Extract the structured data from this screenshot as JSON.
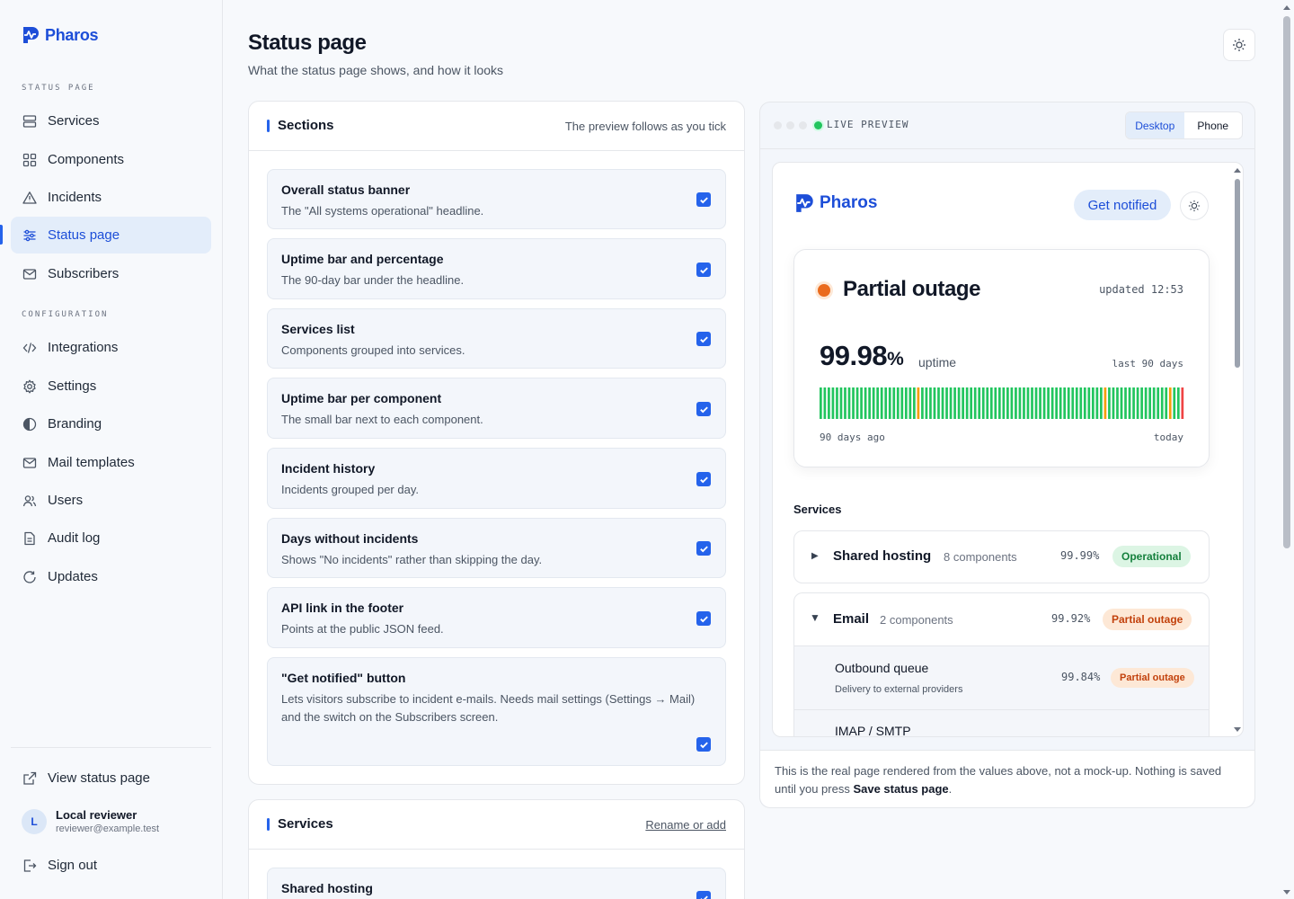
{
  "brand": {
    "name": "Pharos"
  },
  "sidebar": {
    "section_status": "STATUS PAGE",
    "section_config": "CONFIGURATION",
    "items": [
      {
        "label": "Services",
        "icon": "server-icon"
      },
      {
        "label": "Components",
        "icon": "grid-icon"
      },
      {
        "label": "Incidents",
        "icon": "warning-icon"
      },
      {
        "label": "Status page",
        "icon": "sliders-icon",
        "active": true
      },
      {
        "label": "Subscribers",
        "icon": "mail-icon"
      },
      {
        "label": "Integrations",
        "icon": "code-icon"
      },
      {
        "label": "Settings",
        "icon": "gear-icon"
      },
      {
        "label": "Branding",
        "icon": "contrast-icon"
      },
      {
        "label": "Mail templates",
        "icon": "mail-icon"
      },
      {
        "label": "Users",
        "icon": "users-icon"
      },
      {
        "label": "Audit log",
        "icon": "file-icon"
      },
      {
        "label": "Updates",
        "icon": "refresh-icon"
      }
    ],
    "view_status": "View status page",
    "user": {
      "initial": "L",
      "name": "Local reviewer",
      "email": "reviewer@example.test"
    },
    "sign_out": "Sign out"
  },
  "header": {
    "title": "Status page",
    "subtitle": "What the status page shows, and how it looks"
  },
  "sections_card": {
    "title": "Sections",
    "hint": "The preview follows as you tick",
    "options": [
      {
        "title": "Overall status banner",
        "desc": "The \"All systems operational\" headline.",
        "checked": true
      },
      {
        "title": "Uptime bar and percentage",
        "desc": "The 90-day bar under the headline.",
        "checked": true
      },
      {
        "title": "Services list",
        "desc": "Components grouped into services.",
        "checked": true
      },
      {
        "title": "Uptime bar per component",
        "desc": "The small bar next to each component.",
        "checked": true
      },
      {
        "title": "Incident history",
        "desc": "Incidents grouped per day.",
        "checked": true
      },
      {
        "title": "Days without incidents",
        "desc": "Shows \"No incidents\" rather than skipping the day.",
        "checked": true
      },
      {
        "title": "API link in the footer",
        "desc": "Points at the public JSON feed.",
        "checked": true
      },
      {
        "title": "\"Get notified\" button",
        "desc": "Lets visitors subscribe to incident e-mails. Needs mail settings (Settings → Mail) and the switch on the Subscribers screen.",
        "checked": true
      }
    ]
  },
  "services_card": {
    "title": "Services",
    "link": "Rename or add",
    "first_item": "Shared hosting"
  },
  "preview": {
    "label": "LIVE PREVIEW",
    "tabs": [
      "Desktop",
      "Phone"
    ],
    "active_tab": "Desktop",
    "brand": "Pharos",
    "notify": "Get notified",
    "status": "Partial outage",
    "updated": "updated 12:53",
    "uptime_value": "99.98",
    "uptime_unit": "%",
    "uptime_label": "uptime",
    "range_label": "last 90 days",
    "bar_start": "90 days ago",
    "bar_end": "today",
    "days": 90,
    "amber_days": [
      24,
      70,
      86
    ],
    "red_days": [
      89
    ],
    "colors": {
      "ok": "#22c55e",
      "warn": "#f59e0b",
      "down": "#ef4444",
      "accent": "#2563eb",
      "outage_dot": "#ea6b1e"
    },
    "services_heading": "Services",
    "services": [
      {
        "name": "Shared hosting",
        "count": "8 components",
        "uptime": "99.99%",
        "status": "Operational",
        "expanded": false
      },
      {
        "name": "Email",
        "count": "2 components",
        "uptime": "99.92%",
        "status": "Partial outage",
        "expanded": true,
        "components": [
          {
            "name": "Outbound queue",
            "desc": "Delivery to external providers",
            "uptime": "99.84%",
            "status": "Partial outage"
          },
          {
            "name": "IMAP / SMTP"
          }
        ]
      }
    ],
    "footer_note": "This is the real page rendered from the values above, not a mock-up. Nothing is saved until you press ",
    "footer_strong": "Save status page",
    "footer_end": "."
  }
}
